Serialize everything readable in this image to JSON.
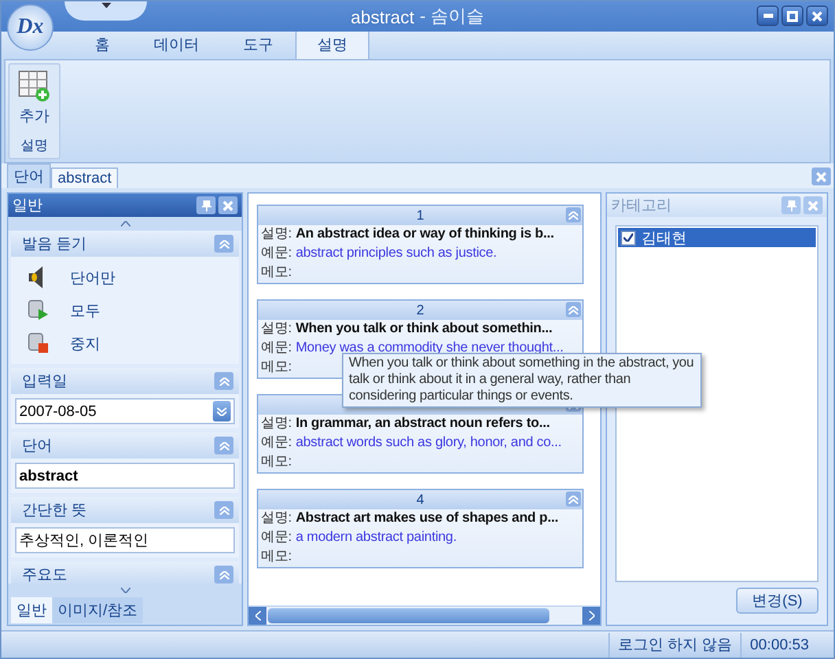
{
  "window": {
    "logo": "Dx",
    "title": "abstract",
    "app": "- 솜이슬"
  },
  "ribbon": {
    "tabs": [
      {
        "label": "홈",
        "selected": false
      },
      {
        "label": "데이터",
        "selected": false
      },
      {
        "label": "도구",
        "selected": false
      },
      {
        "label": "설명",
        "selected": true
      }
    ],
    "group": {
      "button": "추가",
      "label": "설명"
    }
  },
  "doc_tabs": [
    {
      "label": "단어",
      "selected": false
    },
    {
      "label": "abstract",
      "selected": true
    }
  ],
  "left_panel": {
    "title": "일반",
    "sections": [
      {
        "kind": "actions",
        "title": "발음 듣기",
        "items": [
          {
            "kind": "speaker",
            "label": "단어만"
          },
          {
            "kind": "play",
            "label": "모두"
          },
          {
            "kind": "stop",
            "label": "중지"
          }
        ]
      },
      {
        "kind": "date",
        "title": "입력일",
        "value": "2007-08-05"
      },
      {
        "kind": "text",
        "title": "단어",
        "value": "abstract",
        "bold": true
      },
      {
        "kind": "text",
        "title": "간단한 뜻",
        "value": "추상적인, 이론적인",
        "bold": false
      },
      {
        "kind": "header",
        "title": "주요도"
      }
    ],
    "tabs": [
      {
        "label": "일반",
        "selected": true
      },
      {
        "label": "이미지/참조",
        "selected": false
      }
    ]
  },
  "cards": [
    {
      "number": "1",
      "meaning_label": "설명:",
      "meaning": "An abstract idea or way of thinking is b...",
      "example_label": "예문:",
      "example": "abstract principles such as justice.",
      "memo_label": "메모:"
    },
    {
      "number": "2",
      "meaning_label": "설명:",
      "meaning": "When you talk or think about somethin...",
      "example_label": "예문:",
      "example": "Money was a commodity she never thought...",
      "memo_label": "메모:"
    },
    {
      "meaning_label": "설명:",
      "meaning": "In grammar, an abstract noun refers to...",
      "example_label": "예문:",
      "example": "abstract words such as glory, honor, and co...",
      "memo_label": "메모:"
    },
    {
      "number": "4",
      "meaning_label": "설명:",
      "meaning": "Abstract art makes use of shapes and p...",
      "example_label": "예문:",
      "example": "a modern abstract painting.",
      "memo_label": "메모:"
    }
  ],
  "tooltip": "When you talk or think about something in the abstract, you talk or think about it in a general way, rather than considering particular things or events.",
  "category_panel": {
    "title": "카테고리",
    "items": [
      {
        "label": "김태현",
        "checked": true,
        "selected": true
      }
    ],
    "button": "변경(S)"
  },
  "status_bar": {
    "login": "로그인 하지 않음",
    "time": "00:00:53"
  }
}
